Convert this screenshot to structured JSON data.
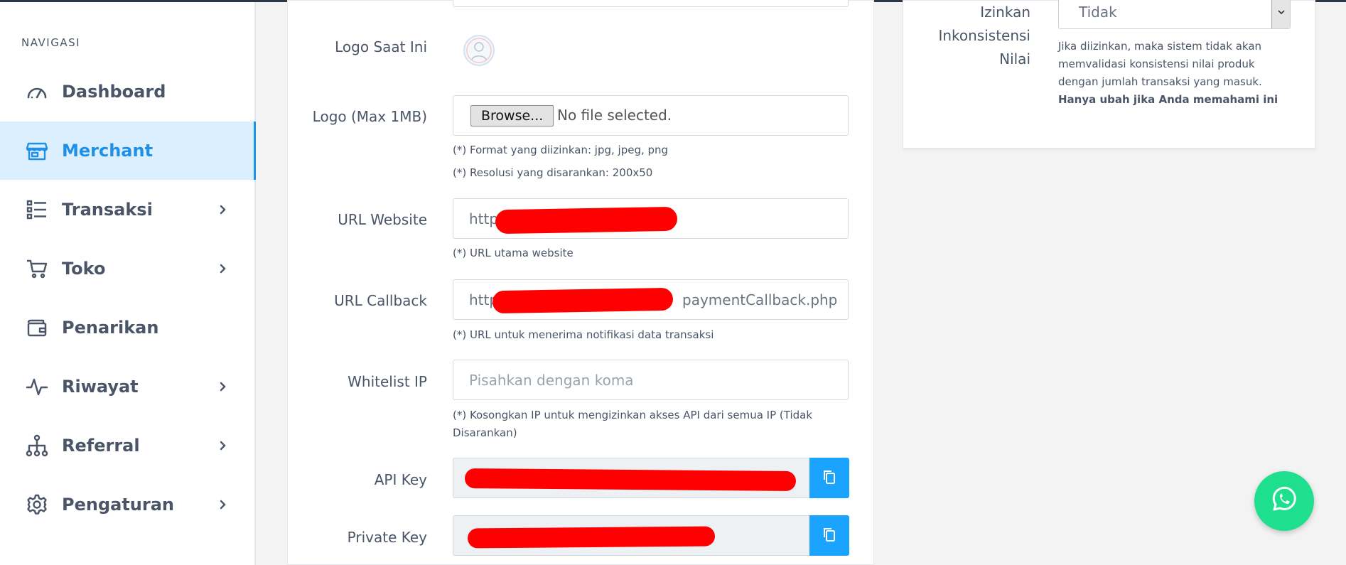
{
  "sidebar": {
    "heading": "NAVIGASI",
    "items": [
      {
        "label": "Dashboard",
        "icon": "speedometer-icon",
        "active": false,
        "has_children": false
      },
      {
        "label": "Merchant",
        "icon": "store-icon",
        "active": true,
        "has_children": false
      },
      {
        "label": "Transaksi",
        "icon": "list-icon",
        "active": false,
        "has_children": true
      },
      {
        "label": "Toko",
        "icon": "cart-icon",
        "active": false,
        "has_children": true
      },
      {
        "label": "Penarikan",
        "icon": "wallet-icon",
        "active": false,
        "has_children": false
      },
      {
        "label": "Riwayat",
        "icon": "activity-icon",
        "active": false,
        "has_children": true
      },
      {
        "label": "Referral",
        "icon": "network-icon",
        "active": false,
        "has_children": true
      },
      {
        "label": "Pengaturan",
        "icon": "gear-icon",
        "active": false,
        "has_children": true
      }
    ]
  },
  "form": {
    "logo_current_label": "Logo Saat Ini",
    "logo_upload_label": "Logo (Max 1MB)",
    "browse_label": "Browse...",
    "file_status": "No file selected.",
    "logo_help_format": "(*) Format yang diizinkan: jpg, jpeg, png",
    "logo_help_resolution": "(*) Resolusi yang disarankan: 200x50",
    "url_website_label": "URL Website",
    "url_website_value": "http",
    "url_website_help": "(*) URL utama website",
    "url_callback_label": "URL Callback",
    "url_callback_prefix": "http",
    "url_callback_suffix": "paymentCallback.php",
    "url_callback_help": "(*) URL untuk menerima notifikasi data transaksi",
    "whitelist_label": "Whitelist IP",
    "whitelist_placeholder": "Pisahkan dengan koma",
    "whitelist_help_1": "(*) Kosongkan IP untuk mengizinkan akses API dari semua IP (Tidak",
    "whitelist_help_2": "Disarankan)",
    "api_key_label": "API Key",
    "private_key_label": "Private Key"
  },
  "right_panel": {
    "label_line1": "Izinkan",
    "label_line2": "Inkonsistensi",
    "label_line3": "Nilai",
    "select_value": "Tidak",
    "help_normal": "Jika diizinkan, maka sistem tidak akan memvalidasi konsistensi nilai produk dengan jumlah transaksi yang masuk.",
    "help_bold": "Hanya ubah jika Anda memahami ini"
  },
  "colors": {
    "accent": "#1e90e6",
    "active_bg": "#dcefff",
    "copy_button": "#1aa3ff",
    "whatsapp": "#1ddf8e",
    "redaction": "#ff0000"
  }
}
